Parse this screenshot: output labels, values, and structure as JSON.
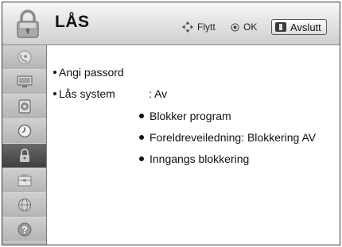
{
  "header": {
    "title": "LÅS",
    "move_hint": "Flytt",
    "ok_hint": "OK",
    "exit_label": "Avslutt",
    "icon": "padlock-icon"
  },
  "sidebar": {
    "items": [
      {
        "icon": "satellite-dish-icon",
        "active": false
      },
      {
        "icon": "tv-screen-icon",
        "active": false
      },
      {
        "icon": "speaker-icon",
        "active": false
      },
      {
        "icon": "clock-icon",
        "active": false
      },
      {
        "icon": "padlock-icon",
        "active": true
      },
      {
        "icon": "toolbox-icon",
        "active": false
      },
      {
        "icon": "globe-network-icon",
        "active": false
      },
      {
        "icon": "help-icon",
        "active": false
      }
    ]
  },
  "menu": {
    "items": [
      {
        "label": "Angi passord"
      },
      {
        "label": "Lås system",
        "value": ": Av"
      }
    ],
    "sub_items": [
      {
        "label": "Blokker program"
      },
      {
        "label": "Foreldreveiledning: Blokkering AV"
      },
      {
        "label": "Inngangs blokkering"
      }
    ]
  },
  "colors": {
    "header_bg": "#e4e4e4",
    "sidebar_bg": "#bdbdbd",
    "active_item_bg": "#4a4a4a"
  }
}
